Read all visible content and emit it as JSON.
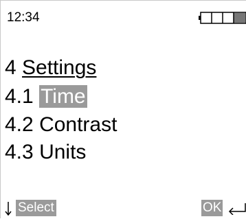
{
  "status_bar": {
    "time": "12:34",
    "battery_level": 0.25
  },
  "menu": {
    "heading_number": "4",
    "heading_label": "Settings",
    "items": [
      {
        "number": "4.1",
        "label": "Time",
        "selected": true
      },
      {
        "number": "4.2",
        "label": "Contrast",
        "selected": false
      },
      {
        "number": "4.3",
        "label": "Units",
        "selected": false
      }
    ]
  },
  "softkeys": {
    "left_label": "Select",
    "right_label": "OK",
    "left_icon": "arrow-down-icon",
    "right_icon": "enter-icon"
  },
  "colors": {
    "highlight": "#9a9a9a",
    "text": "#000000",
    "background": "#ffffff"
  }
}
